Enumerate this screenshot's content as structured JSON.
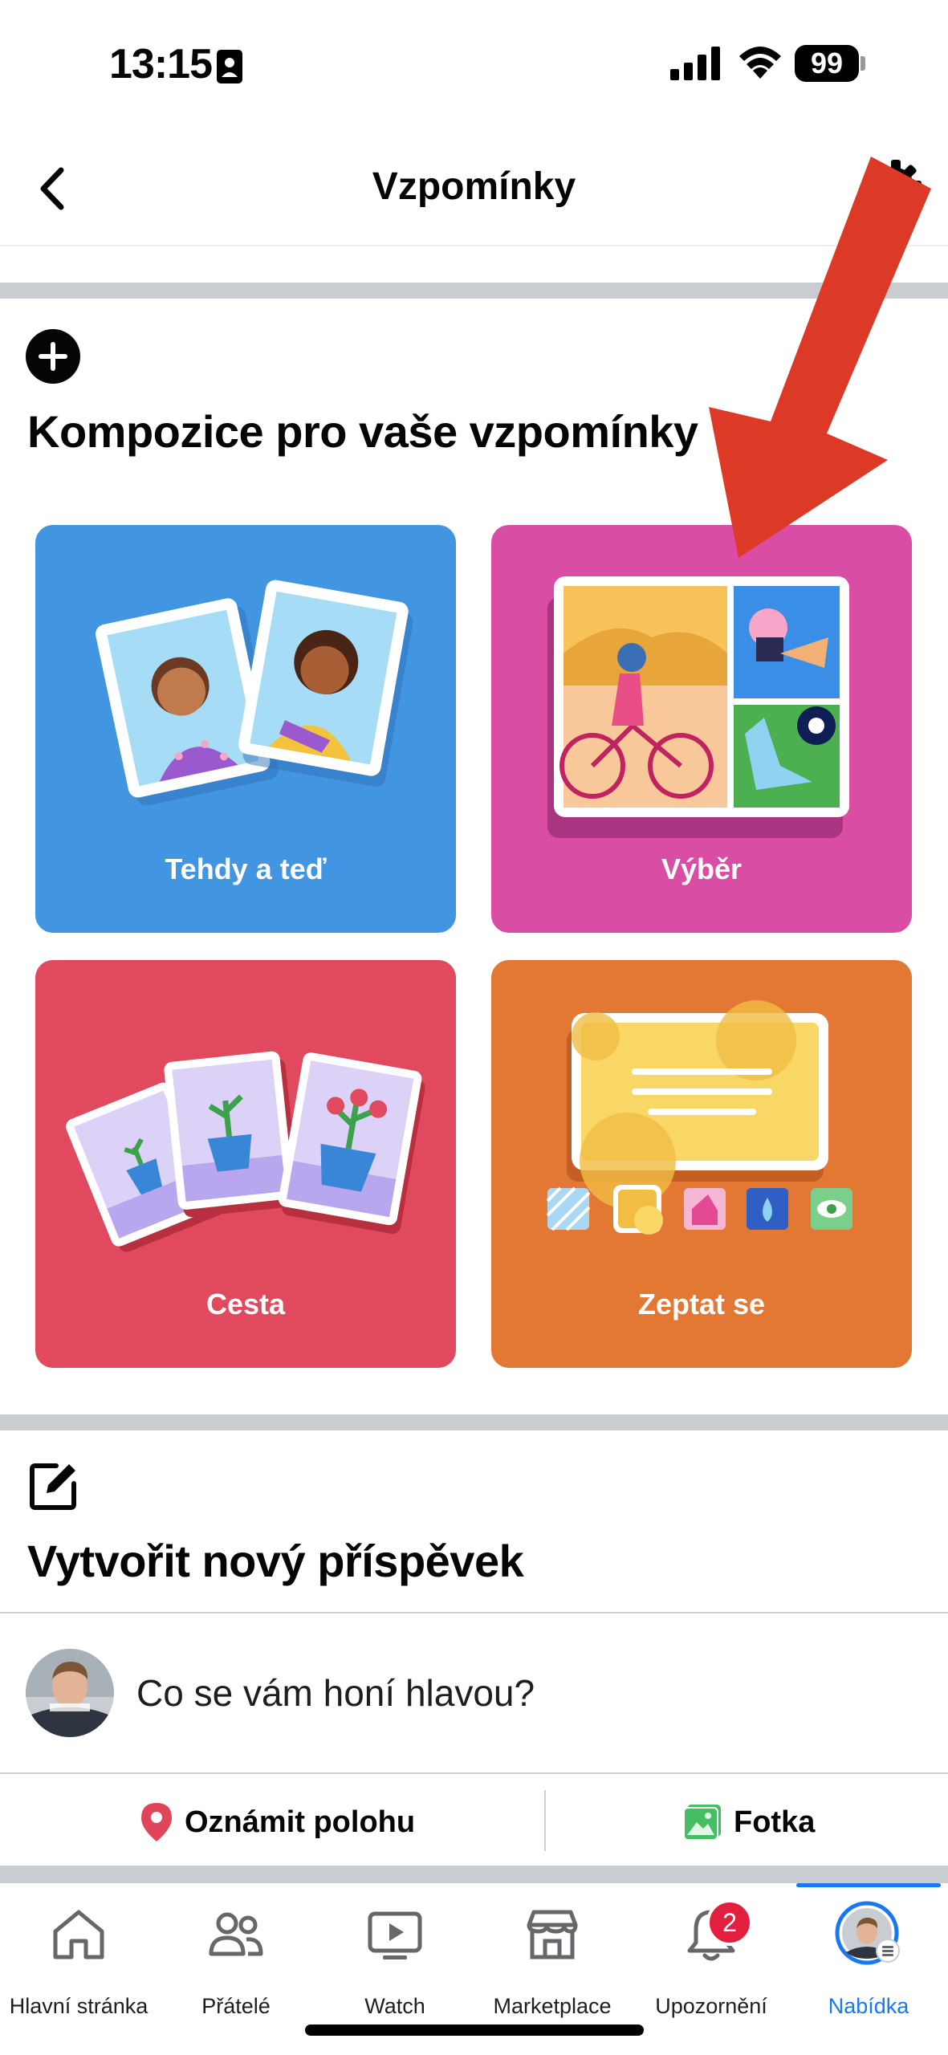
{
  "status_bar": {
    "time": "13:15",
    "battery_level": "99"
  },
  "header": {
    "title": "Vzpomínky"
  },
  "compositions": {
    "title": "Kompozice pro vaše vzpomínky",
    "cards": [
      {
        "label": "Tehdy a teď",
        "color": "#4295e0"
      },
      {
        "label": "Výběr",
        "color": "#d94da4"
      },
      {
        "label": "Cesta",
        "color": "#e14a5e"
      },
      {
        "label": "Zeptat se",
        "color": "#e37734"
      }
    ]
  },
  "create_post": {
    "title": "Vytvořit nový příspěvek",
    "placeholder": "Co se vám honí hlavou?",
    "actions": {
      "location": "Oznámit polohu",
      "photo": "Fotka"
    }
  },
  "tab_bar": {
    "tabs": [
      {
        "label": "Hlavní stránka",
        "icon": "home-icon"
      },
      {
        "label": "Přátelé",
        "icon": "friends-icon"
      },
      {
        "label": "Watch",
        "icon": "watch-icon"
      },
      {
        "label": "Marketplace",
        "icon": "marketplace-icon"
      },
      {
        "label": "Upozornění",
        "icon": "bell-icon"
      },
      {
        "label": "Nabídka",
        "icon": "menu-avatar-icon"
      }
    ],
    "notification_count": "2",
    "active_tab": "Nabídka",
    "active_color": "#1877f2"
  },
  "annotation": {
    "arrow_color": "#dc3a26"
  }
}
